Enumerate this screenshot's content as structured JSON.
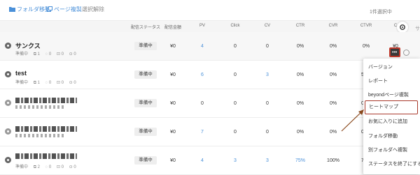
{
  "toolbar": {
    "move_folder": "フォルダ移動",
    "copy_page": "ページ複製",
    "deselect": "選択解除",
    "selected_count": "1件選択中"
  },
  "columns": [
    "配信ステータス",
    "配信金額",
    "PV",
    "Click",
    "CV",
    "CTR",
    "CVR",
    "CTVR",
    "C"
  ],
  "rows": [
    {
      "name": "サンクス",
      "meta": {
        "status": "準備中",
        "pages": "1",
        "wifi": "0",
        "links": "0",
        "clicks": "0"
      },
      "cells": {
        "status": "準備中",
        "amount": "¥0",
        "pv": "4",
        "click": "0",
        "cv": "0",
        "ctr": "0%",
        "cvr": "0%",
        "ctvr": "0%",
        "c": "¥0"
      }
    },
    {
      "name": "test",
      "meta": {
        "status": "準備中",
        "pages": "1",
        "wifi": "0",
        "links": "0",
        "clicks": "0"
      },
      "cells": {
        "status": "準備中",
        "amount": "¥0",
        "pv": "6",
        "click": "0",
        "cv": "3",
        "ctr": "0%",
        "cvr": "0%",
        "ctvr": "5"
      }
    },
    {
      "cells": {
        "status": "準備中",
        "amount": "¥0",
        "pv": "0",
        "click": "0",
        "cv": "0",
        "ctr": "0%",
        "cvr": "0%",
        "ctvr": "0"
      }
    },
    {
      "cells": {
        "status": "準備中",
        "amount": "¥0",
        "pv": "7",
        "click": "0",
        "cv": "0",
        "ctr": "0%",
        "cvr": "0%",
        "ctvr": "0"
      }
    },
    {
      "meta": {
        "status": "準備中",
        "pages": "2",
        "wifi": "0",
        "links": "0",
        "clicks": "0"
      },
      "cells": {
        "status": "準備中",
        "amount": "¥0",
        "pv": "4",
        "click": "3",
        "cv": "3",
        "ctr": "75%",
        "cvr": "100%",
        "ctvr": "7"
      }
    }
  ],
  "menu": {
    "items": [
      "バージョン",
      "レポート",
      "beyondページ複製",
      "ヒートマップ",
      "お気に入りに追加",
      "フォルダ移動",
      "別フォルダへ複製",
      "ステータスを終了にする"
    ]
  },
  "edge_text": {
    "top": "サ",
    "mid": "フ"
  },
  "colors": {
    "link": "#4a90d9",
    "highlight_border": "#a8382a",
    "arrow": "#8b4a1f"
  }
}
